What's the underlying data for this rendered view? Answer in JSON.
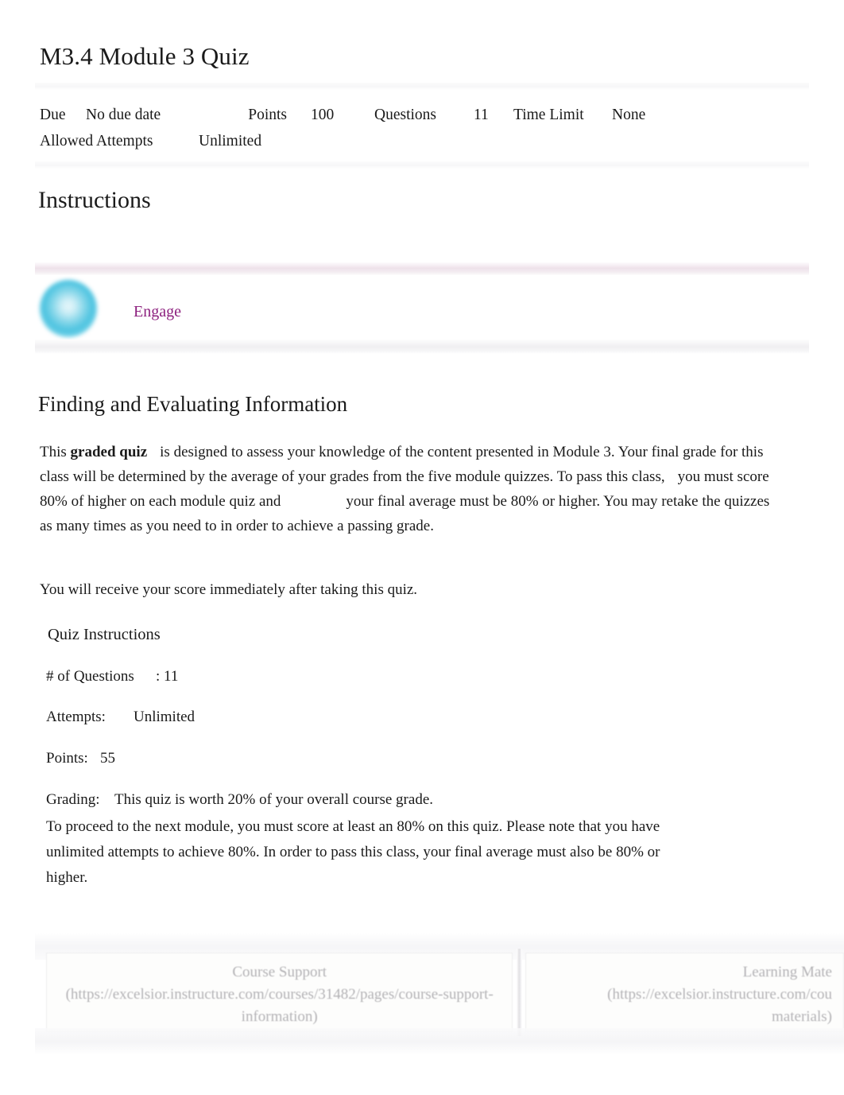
{
  "quiz": {
    "title": "M3.4 Module 3 Quiz",
    "meta": {
      "due_label": "Due",
      "due_value": "No due date",
      "points_label": "Points",
      "points_value": "100",
      "questions_label": "Questions",
      "questions_value": "11",
      "time_limit_label": "Time Limit",
      "time_limit_value": "None",
      "allowed_attempts_label": "Allowed Attempts",
      "allowed_attempts_value": "Unlimited"
    }
  },
  "instructions_heading": "Instructions",
  "banner": {
    "label": "Engage",
    "icon": "engage-glow-icon",
    "label_color": "#8c1f7e",
    "icon_color": "#4cc3e0",
    "top_bar_color": "#eee2ea",
    "bottom_bar_color": "#f0eff1"
  },
  "content": {
    "section_heading": "Finding and Evaluating Information",
    "paragraph_1_parts": {
      "before": "This ",
      "emphasis": "graded quiz",
      "middle": "is designed to assess your knowledge of the content presented in Module 3. Your final grade for this class will be determined by the average of your grades from the five module quizzes. To pass this class,",
      "after": "you must score 80% of higher on each module quiz and",
      "tail": "your final average must be 80% or higher. You may retake the quizzes as many times as you need to in order to achieve a passing grade."
    },
    "paragraph_2": "You will receive your score immediately after taking this quiz."
  },
  "quiz_instructions": {
    "title": "Quiz Instructions",
    "rows": [
      {
        "key": "# of Questions",
        "value": ": 11"
      },
      {
        "key": "Attempts:",
        "value": "Unlimited"
      },
      {
        "key": "Points:",
        "value": "55"
      },
      {
        "key": "Grading:",
        "value": "This quiz is worth 20% of your overall course grade."
      }
    ],
    "note": "To proceed to the next module, you must score at least an 80% on this quiz. Please note that you have unlimited attempts to achieve 80%. In order to pass this class, your final average must also be 80% or higher."
  },
  "footer": {
    "cells": [
      {
        "title": "Course Support",
        "url": "(https://excelsior.instructure.com/courses/31482/pages/course-support-information)"
      },
      {
        "title": "Learning Mate",
        "url": "(https://excelsior.instructure.com/cou",
        "url_tail": "materials)"
      }
    ]
  }
}
